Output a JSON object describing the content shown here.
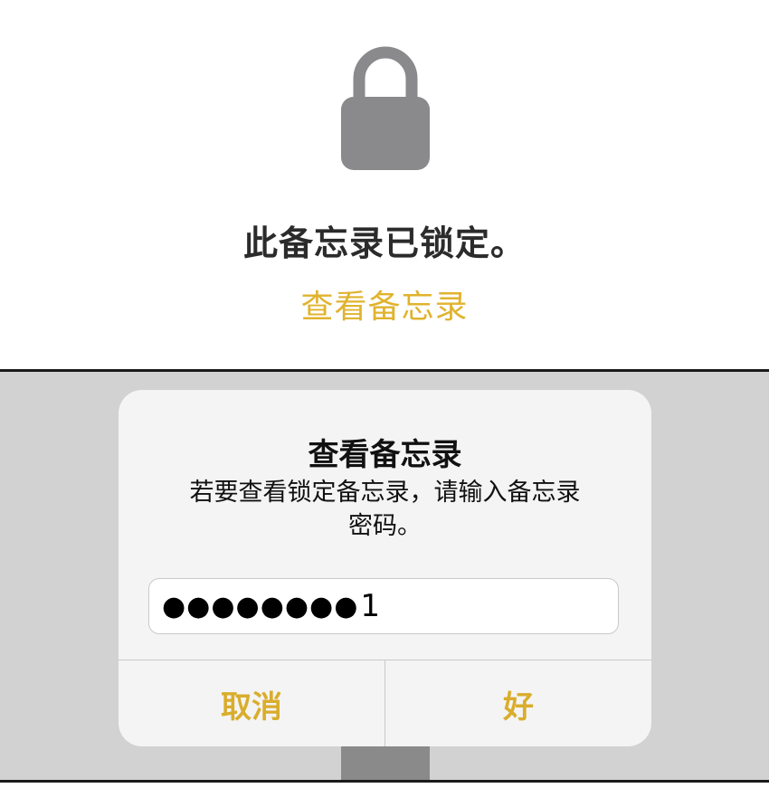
{
  "lock_screen": {
    "icon": "lock-icon",
    "title": "此备忘录已锁定。",
    "view_link": "查看备忘录"
  },
  "dialog": {
    "title": "查看备忘录",
    "message_line1": "若要查看锁定备忘录，请输入备忘录",
    "message_line2": "密码。",
    "password_masked": "●●●●●●●●",
    "password_last_char": "1",
    "cancel_label": "取消",
    "ok_label": "好"
  },
  "colors": {
    "accent": "#e0b32e",
    "lock_gray": "#8a8a8c",
    "overlay": "#d2d2d2"
  }
}
